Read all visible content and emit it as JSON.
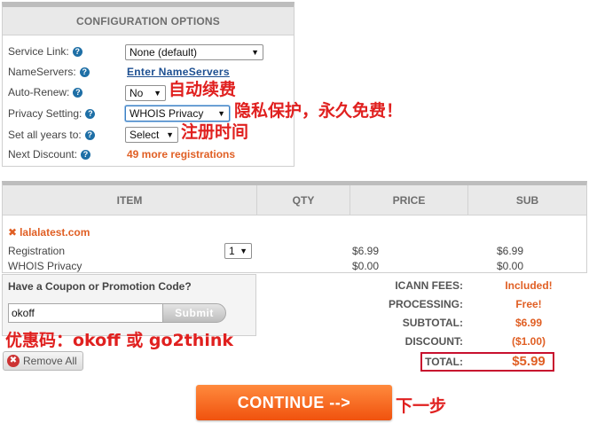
{
  "config": {
    "title": "CONFIGURATION OPTIONS",
    "rows": [
      {
        "label": "Service Link:",
        "value": "None (default)"
      },
      {
        "label": "NameServers:",
        "value": "Enter NameServers"
      },
      {
        "label": "Auto-Renew:",
        "value": "No"
      },
      {
        "label": "Privacy Setting:",
        "value": "WHOIS Privacy"
      },
      {
        "label": "Set all years to:",
        "value": "Select"
      },
      {
        "label": "Next Discount:",
        "value": "49 more registrations"
      }
    ],
    "help_glyph": "?"
  },
  "annotations": {
    "auto_renew": "自动续费",
    "privacy": "隐私保护，永久免费！",
    "years": "注册时间",
    "coupon": "优惠码：okoff 或 go2think",
    "continue": "下一步"
  },
  "items": {
    "headers": [
      "ITEM",
      "QTY",
      "PRICE",
      "SUB"
    ],
    "domain": "lalalatest.com",
    "remove_glyph": "✖",
    "rows": [
      {
        "name": "Registration",
        "qty": "1",
        "price": "$6.99",
        "sub": "$6.99"
      },
      {
        "name": "WHOIS Privacy",
        "qty": "",
        "price": "$0.00",
        "sub": "$0.00"
      }
    ]
  },
  "coupon": {
    "title": "Have a Coupon or Promotion Code?",
    "value": "okoff",
    "submit_label": "Submit"
  },
  "remove_all_label": "Remove All",
  "totals": [
    {
      "label": "ICANN FEES:",
      "value": "Included!"
    },
    {
      "label": "PROCESSING:",
      "value": "Free!"
    },
    {
      "label": "SUBTOTAL:",
      "value": "$6.99"
    },
    {
      "label": "DISCOUNT:",
      "value": "($1.00)"
    },
    {
      "label": "TOTAL:",
      "value": "$5.99"
    }
  ],
  "continue_label": "CONTINUE -->",
  "colors": {
    "accent": "#e05f24",
    "link": "#1d4f91",
    "annotation": "#e0201f",
    "help": "#1e6fa6"
  }
}
